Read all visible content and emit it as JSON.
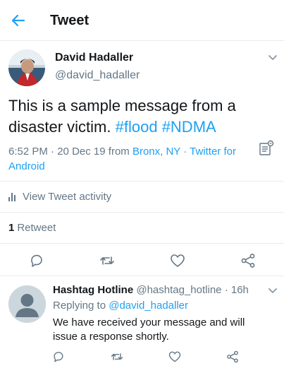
{
  "header": {
    "title": "Tweet",
    "back_icon": "arrow-left-icon"
  },
  "tweet": {
    "author_name": "David Hadaller",
    "author_handle": "@david_hadaller",
    "text_plain": "This is a sample message from a disaster victim.",
    "hashtags": [
      "#flood",
      "#NDMA"
    ],
    "time": "6:52 PM",
    "date": "20 Dec 19",
    "from_label": "from",
    "location": "Bronx, NY",
    "separator": "·",
    "source": "Twitter for Android",
    "activity_label": "View Tweet activity",
    "retweet_count": "1",
    "retweet_label": "Retweet"
  },
  "reply": {
    "author_name": "Hashtag Hotline",
    "author_handle": "@hashtag_hotline",
    "separator": "·",
    "time": "16h",
    "replying_to_label": "Replying to",
    "replying_to_handle": "@david_hadaller",
    "text": "We have received your message and will issue a response shortly."
  },
  "colors": {
    "accent": "#1da1f2",
    "text_primary": "#14171a",
    "text_secondary": "#657786",
    "divider": "#e6ecf0"
  },
  "icons": {
    "back": "arrow-left-icon",
    "more": "chevron-down-icon",
    "analytics": "bar-chart-icon",
    "reply": "reply-icon",
    "retweet": "retweet-icon",
    "like": "heart-icon",
    "share": "share-icon",
    "meta": "note-icon"
  }
}
